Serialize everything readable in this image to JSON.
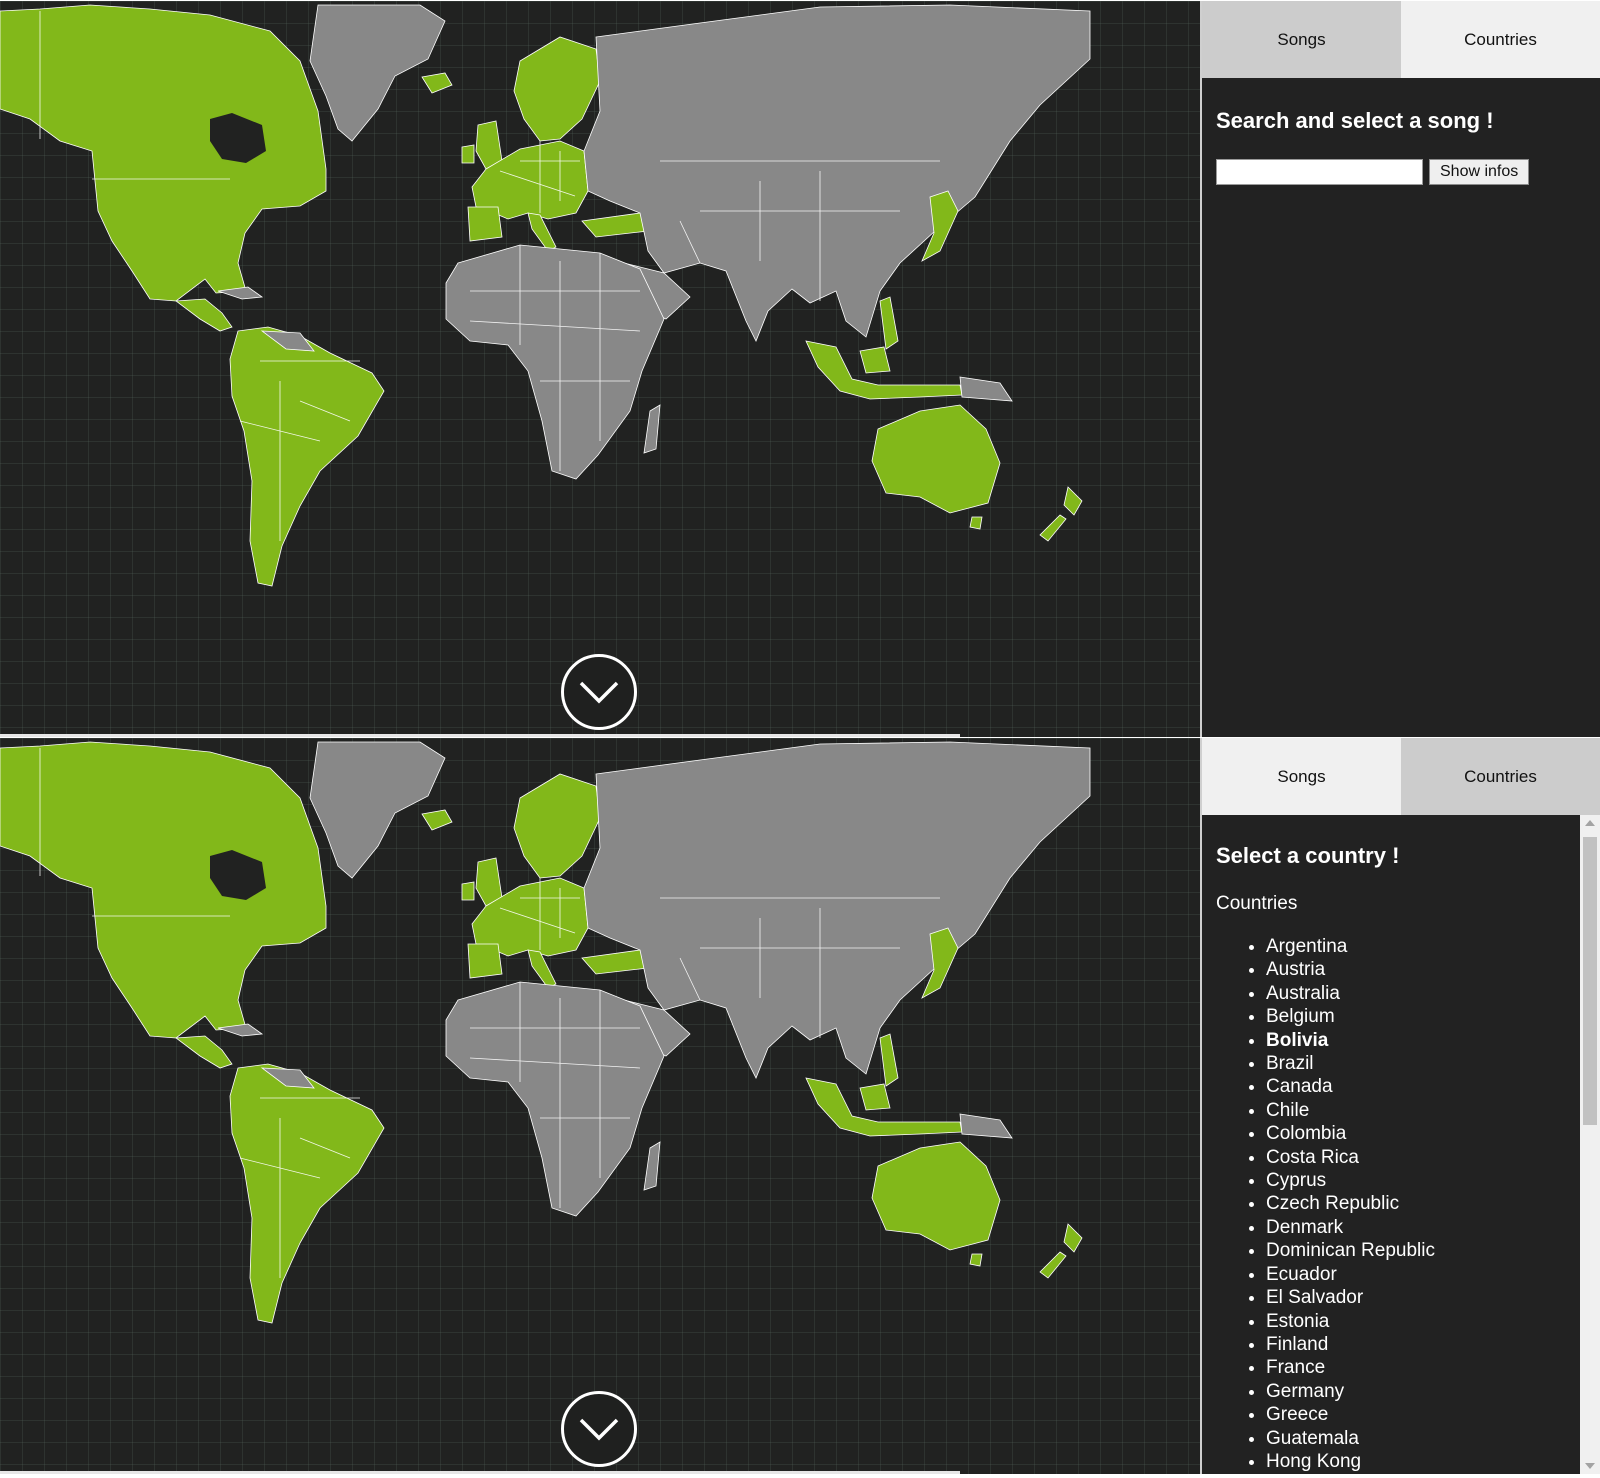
{
  "map": {
    "highlight_color": "#82b81a",
    "base_color": "#888888",
    "border_color": "#ffffff",
    "background_color": "#212221"
  },
  "scroll_button": {
    "icon": "chevron-down-icon"
  },
  "songs_view": {
    "tabs": [
      {
        "label": "Songs"
      },
      {
        "label": "Countries"
      }
    ],
    "active_tab": "Songs",
    "title": "Search and select a song !",
    "search": {
      "value": "",
      "placeholder": ""
    },
    "show_button_label": "Show infos"
  },
  "countries_view": {
    "tabs": [
      {
        "label": "Songs"
      },
      {
        "label": "Countries"
      }
    ],
    "active_tab": "Countries",
    "title": "Select a country !",
    "list_label": "Countries",
    "selected_country": "Bolivia",
    "countries": [
      "Argentina",
      "Austria",
      "Australia",
      "Belgium",
      "Bolivia",
      "Brazil",
      "Canada",
      "Chile",
      "Colombia",
      "Costa Rica",
      "Cyprus",
      "Czech Republic",
      "Denmark",
      "Dominican Republic",
      "Ecuador",
      "El Salvador",
      "Estonia",
      "Finland",
      "France",
      "Germany",
      "Greece",
      "Guatemala",
      "Hong Kong"
    ]
  }
}
